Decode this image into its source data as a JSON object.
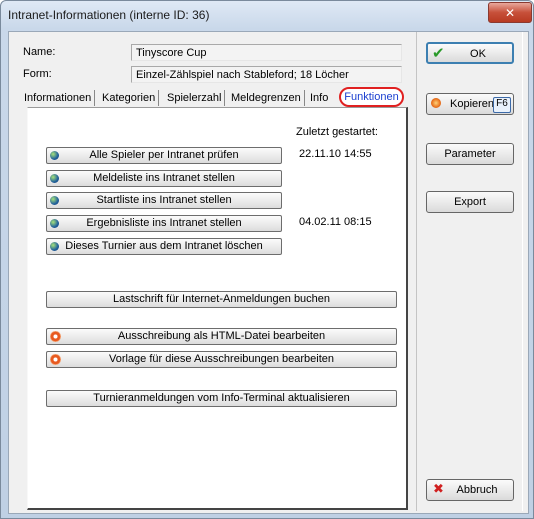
{
  "window": {
    "title": "Intranet-Informationen (interne ID: 36)",
    "close_label": "✕"
  },
  "header": {
    "name_label": "Name:",
    "name_value": "Tinyscore Cup",
    "form_label": "Form:",
    "form_value": "Einzel-Zählspiel nach Stableford; 18 Löcher"
  },
  "tabs": [
    {
      "label": "Informationen"
    },
    {
      "label": "Kategorien"
    },
    {
      "label": "Spielerzahl"
    },
    {
      "label": "Meldegrenzen"
    },
    {
      "label": "Info"
    },
    {
      "label": "Funktionen",
      "active": true
    }
  ],
  "panel": {
    "last_started_label": "Zuletzt gestartet:",
    "intranet_buttons": [
      {
        "label": "Alle Spieler per Intranet prüfen",
        "last_started": "22.11.10 14:55"
      },
      {
        "label": "Meldeliste ins Intranet stellen",
        "last_started": ""
      },
      {
        "label": "Startliste ins Intranet stellen",
        "last_started": ""
      },
      {
        "label": "Ergebnisliste ins Intranet stellen",
        "last_started": "04.02.11 08:15"
      },
      {
        "label": "Dieses Turnier aus dem Intranet löschen",
        "last_started": ""
      }
    ],
    "debit_button": "Lastschrift für Internet-Anmeldungen buchen",
    "html_buttons": [
      {
        "label": "Ausschreibung als HTML-Datei bearbeiten"
      },
      {
        "label": "Vorlage für diese Ausschreibungen bearbeiten"
      }
    ],
    "terminal_button": "Turnieranmeldungen vom Info-Terminal aktualisieren"
  },
  "side_buttons": {
    "ok": "OK",
    "copy": "Kopieren",
    "copy_key": "F6",
    "parameters": "Parameter",
    "export": "Export",
    "cancel": "Abbruch"
  },
  "colors": {
    "active_tab_outline": "#e02020",
    "active_tab_text": "#1b3fd0",
    "ok_check": "#2a9a2a",
    "cancel_x": "#d02020"
  }
}
